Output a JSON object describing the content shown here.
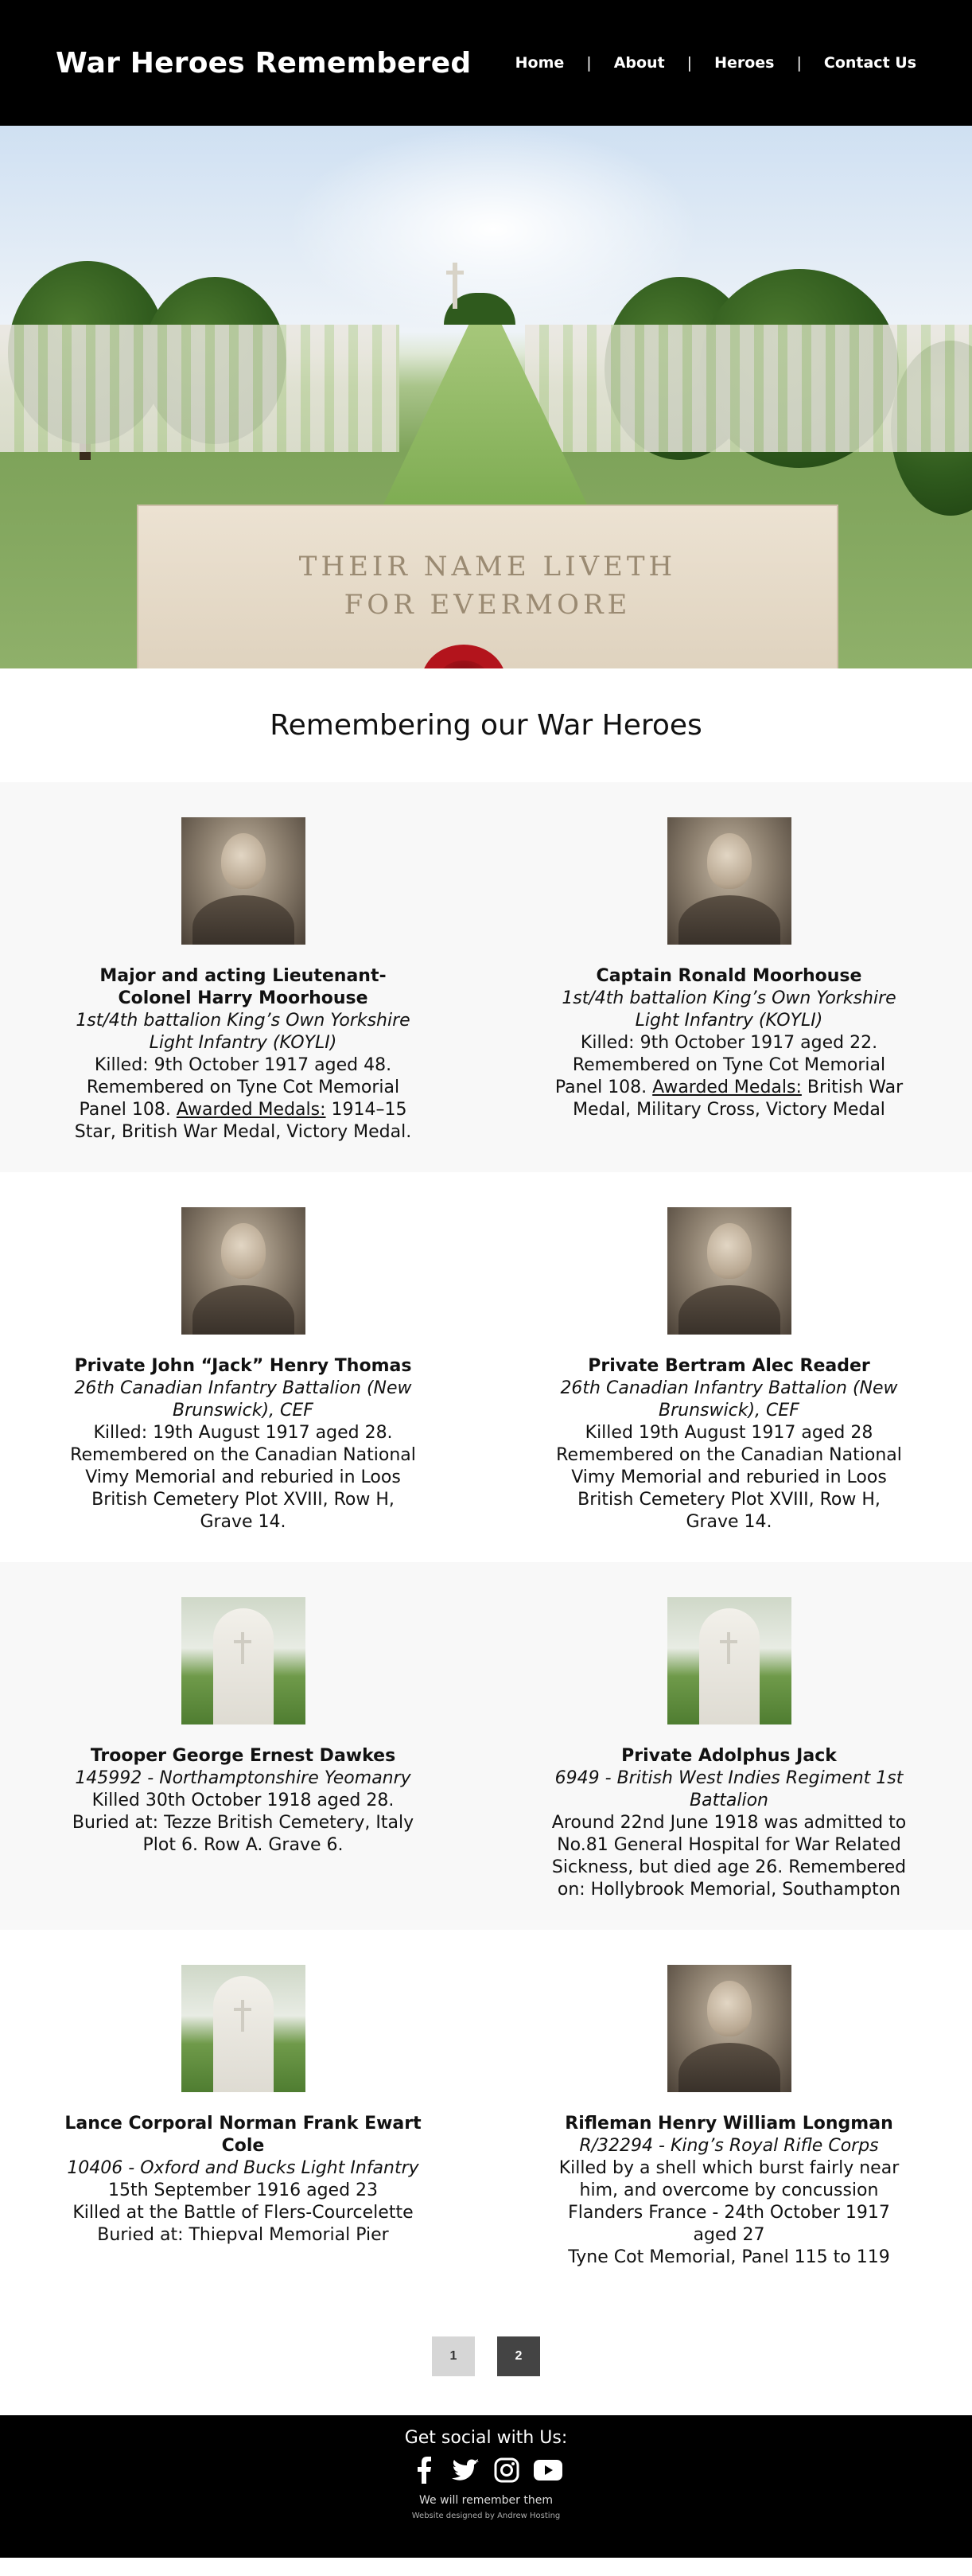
{
  "header": {
    "site_title": "War Heroes Remembered",
    "nav": [
      {
        "label": "Home"
      },
      {
        "label": "About"
      },
      {
        "label": "Heroes"
      },
      {
        "label": "Contact Us"
      }
    ],
    "separator": "|"
  },
  "hero_image": {
    "inscription_line1": "THEIR NAME LIVETH",
    "inscription_line2": "FOR EVERMORE"
  },
  "section_title": "Remembering our War Heroes",
  "heroes": [
    {
      "name": "Major and acting Lieutenant-Colonel Harry Moorhouse",
      "unit": "1st/4th battalion King’s Own Yorkshire Light Infantry (KOYLI)",
      "details": "Killed: 9th October 1917 aged 48. Remembered on Tyne Cot Memorial Panel 108.",
      "medals_label": "Awarded Medals:",
      "medals": " 1914–15 Star, British War Medal, Victory Medal.",
      "image": "portrait-photo"
    },
    {
      "name": "Captain Ronald Moorhouse",
      "unit": "1st/4th battalion King’s Own Yorkshire Light Infantry (KOYLI)",
      "details": "Killed: 9th October 1917 aged 22. Remembered on Tyne Cot Memorial Panel 108.",
      "medals_label": "Awarded Medals:",
      "medals": " British War Medal, Military Cross, Victory Medal",
      "image": "portrait-photo"
    },
    {
      "name": "Private John “Jack” Henry Thomas",
      "unit": "26th Canadian Infantry Battalion (New Brunswick), CEF",
      "details": "Killed: 19th August 1917 aged 28. Remembered on the Canadian National Vimy Memorial and reburied in Loos British Cemetery Plot XVIII, Row H, Grave 14.",
      "image": "portrait-photo"
    },
    {
      "name": "Private Bertram Alec Reader",
      "unit": "26th Canadian Infantry Battalion (New Brunswick), CEF",
      "details": "Killed 19th August 1917 aged 28 Remembered on the Canadian National Vimy Memorial and reburied in Loos British Cemetery Plot XVIII, Row H, Grave 14.",
      "image": "portrait-photo"
    },
    {
      "name": "Trooper George Ernest Dawkes",
      "unit": "145992 - Northamptonshire Yeomanry",
      "details": "Killed 30th October 1918 aged 28. Buried at: Tezze British Cemetery, Italy Plot 6. Row A. Grave 6.",
      "image": "headstone"
    },
    {
      "name": "Private Adolphus Jack",
      "unit": "6949 - British West Indies Regiment 1st Battalion",
      "details": "Around 22nd June 1918 was admitted to No.81 General Hospital for War Related Sickness, but died age 26. Remembered on: Hollybrook Memorial, Southampton",
      "image": "headstone"
    },
    {
      "name": "Lance Corporal Norman Frank Ewart Cole",
      "unit": "10406 - Oxford and Bucks Light Infantry",
      "details_lines": [
        "15th September 1916 aged 23",
        "Killed at the Battle of Flers-Courcelette",
        "Buried at: Thiepval Memorial Pier"
      ],
      "image": "headstone"
    },
    {
      "name": "Rifleman Henry William Longman",
      "unit": "R/32294 - King’s Royal Rifle Corps",
      "details_lines": [
        "Killed by a shell which burst fairly near him, and overcome by concussion",
        "Flanders France - 24th October 1917 aged 27",
        "Tyne Cot Memorial, Panel 115 to 119"
      ],
      "image": "portrait-photo"
    }
  ],
  "pagination": {
    "pages": [
      "1",
      "2"
    ],
    "current": "2"
  },
  "footer": {
    "social_title": "Get social with Us:",
    "social_icons": [
      "facebook-icon",
      "twitter-icon",
      "instagram-icon",
      "youtube-icon"
    ],
    "note": "We will remember them",
    "credit": "Website designed by Andrew Hosting"
  }
}
